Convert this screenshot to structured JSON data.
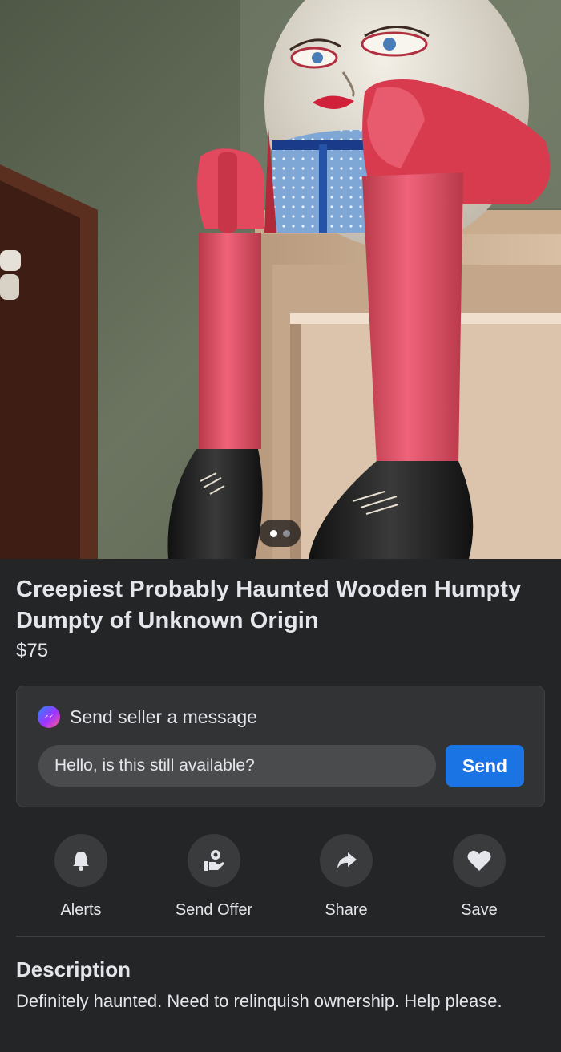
{
  "listing": {
    "title": "Creepiest Probably Haunted Wooden Humpty Dumpty of Unknown Origin",
    "price": "$75",
    "photo_count": 2,
    "active_photo": 1
  },
  "message": {
    "heading": "Send seller a message",
    "input_value": "Hello, is this still available?",
    "send_label": "Send",
    "icon": "messenger-icon"
  },
  "actions": [
    {
      "label": "Alerts",
      "icon": "bell-icon"
    },
    {
      "label": "Send Offer",
      "icon": "offer-icon"
    },
    {
      "label": "Share",
      "icon": "share-icon"
    },
    {
      "label": "Save",
      "icon": "heart-icon"
    }
  ],
  "description": {
    "heading": "Description",
    "body": "Definitely haunted. Need to relinquish ownership. Help please."
  },
  "colors": {
    "background": "#242526",
    "card": "#323335",
    "accent": "#1b74e4",
    "text": "#e4e6eb"
  }
}
